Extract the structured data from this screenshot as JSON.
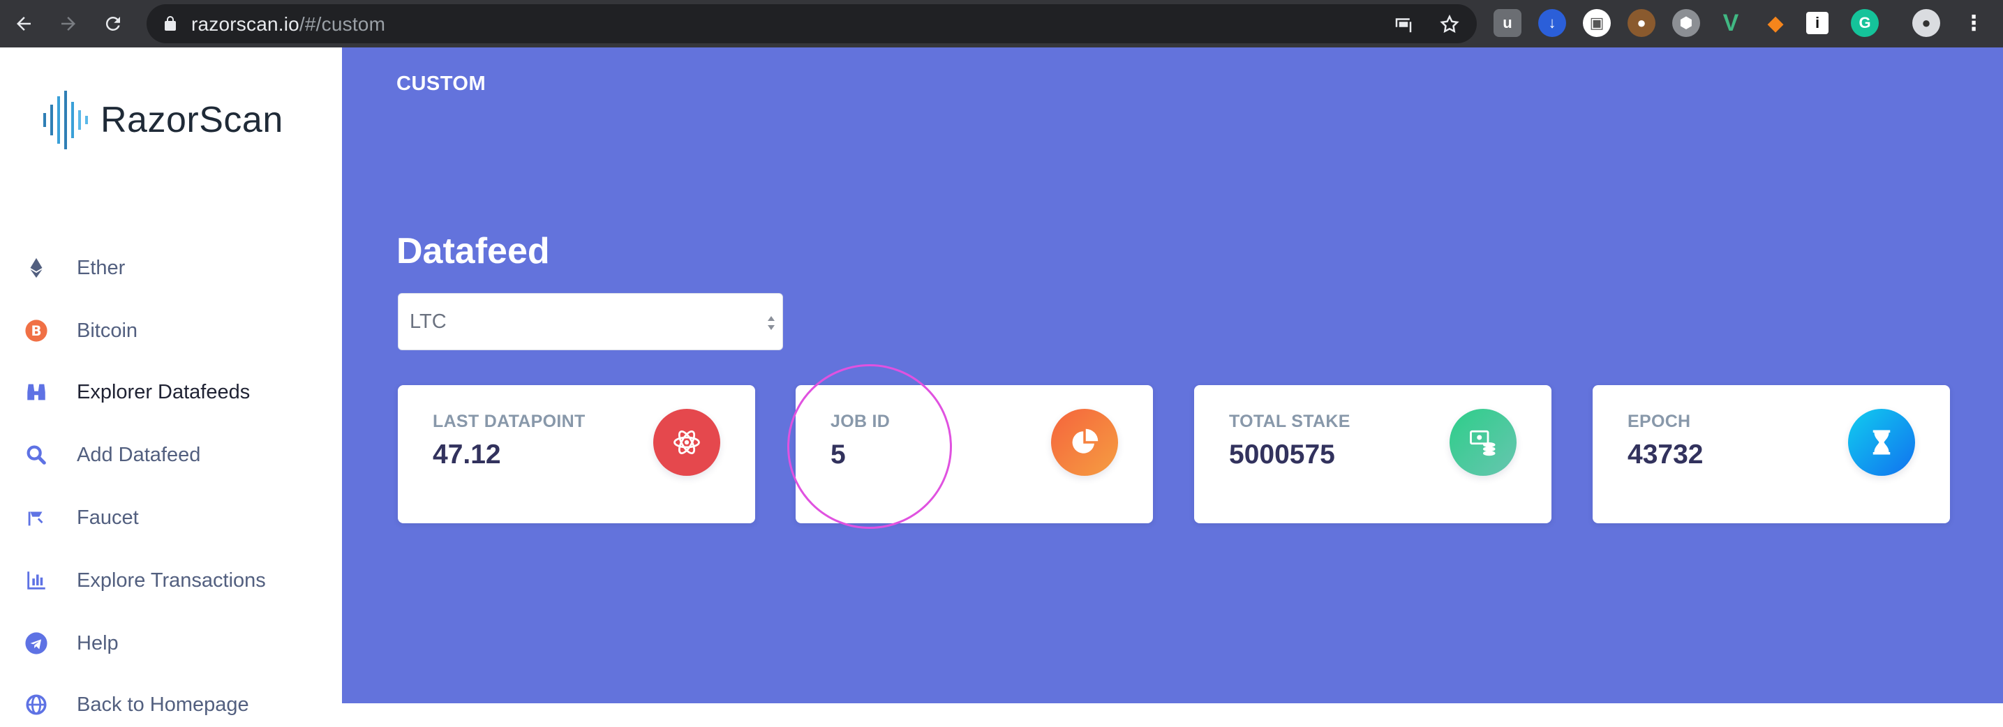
{
  "browser": {
    "url_host": "razorscan.io",
    "url_path": "/#/custom",
    "extensions": [
      "ublock-icon",
      "download-icon",
      "extension-icon",
      "cookie-icon",
      "settings-ext-icon",
      "vue-icon",
      "metamask-icon",
      "info-icon",
      "grammarly-icon"
    ]
  },
  "sidebar": {
    "logo_text": "RazorScan",
    "items": [
      {
        "label": "Ether",
        "icon": "ethereum-icon"
      },
      {
        "label": "Bitcoin",
        "icon": "bitcoin-icon"
      },
      {
        "label": "Explorer Datafeeds",
        "icon": "binoculars-icon"
      },
      {
        "label": "Add Datafeed",
        "icon": "search-icon"
      },
      {
        "label": "Faucet",
        "icon": "faucet-icon"
      },
      {
        "label": "Explore Transactions",
        "icon": "bar-chart-icon"
      },
      {
        "label": "Help",
        "icon": "telegram-icon"
      },
      {
        "label": "Back to Homepage",
        "icon": "globe-icon"
      }
    ]
  },
  "main": {
    "breadcrumb": "CUSTOM",
    "heading": "Datafeed",
    "select": {
      "value": "LTC"
    },
    "cards": [
      {
        "title": "LAST DATAPOINT",
        "value": "47.12",
        "icon": "atom-icon",
        "color": "#e5484d"
      },
      {
        "title": "JOB ID",
        "value": "5",
        "icon": "pie-chart-icon",
        "color": "#f0803c"
      },
      {
        "title": "TOTAL STAKE",
        "value": "5000575",
        "icon": "money-coins-icon",
        "color": "#3fc8a0"
      },
      {
        "title": "EPOCH",
        "value": "43732",
        "icon": "hourglass-icon",
        "color": "#2f8ee6"
      }
    ]
  },
  "colors": {
    "main_bg": "#6373dc",
    "accent": "#5e72e4"
  }
}
